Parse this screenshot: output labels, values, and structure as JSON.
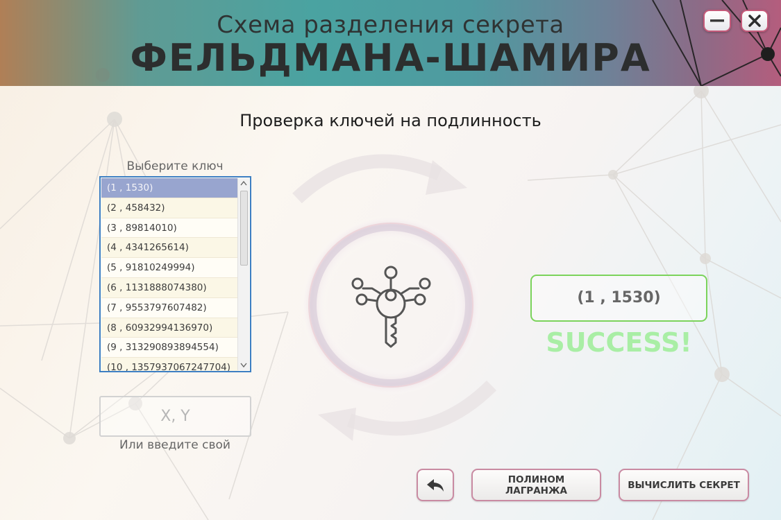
{
  "header": {
    "subtitle": "Схема разделения секрета",
    "title": "ФЕЛЬДМАНА-ШАМИРА"
  },
  "window_controls": {
    "minimize_icon": "minimize-icon",
    "close_icon": "close-icon"
  },
  "page": {
    "section_title": "Проверка ключей на подлинность"
  },
  "key_list": {
    "label": "Выберите ключ",
    "selected_index": 0,
    "items": [
      "(1 , 1530)",
      "(2 , 458432)",
      "(3 , 89814010)",
      "(4 , 4341265614)",
      "(5 , 91810249994)",
      "(6 , 1131888074380)",
      "(7 , 9553797607482)",
      "(8 , 60932994136970)",
      "(9 , 313290893894554)",
      "(10 , 1357937067247704)"
    ]
  },
  "manual_input": {
    "placeholder": "X, Y",
    "value": "",
    "label": "Или введите свой"
  },
  "result": {
    "value": "(1 , 1530)",
    "status": "SUCCESS!",
    "status_color": "#a9eea5",
    "border_color": "#7bd35b"
  },
  "buttons": {
    "back_icon": "back-arrow-icon",
    "lagrange": "ПОЛИНОМ ЛАГРАНЖА",
    "compute": "ВЫЧИСЛИТЬ СЕКРЕТ"
  },
  "center_icon": "key-network-icon"
}
